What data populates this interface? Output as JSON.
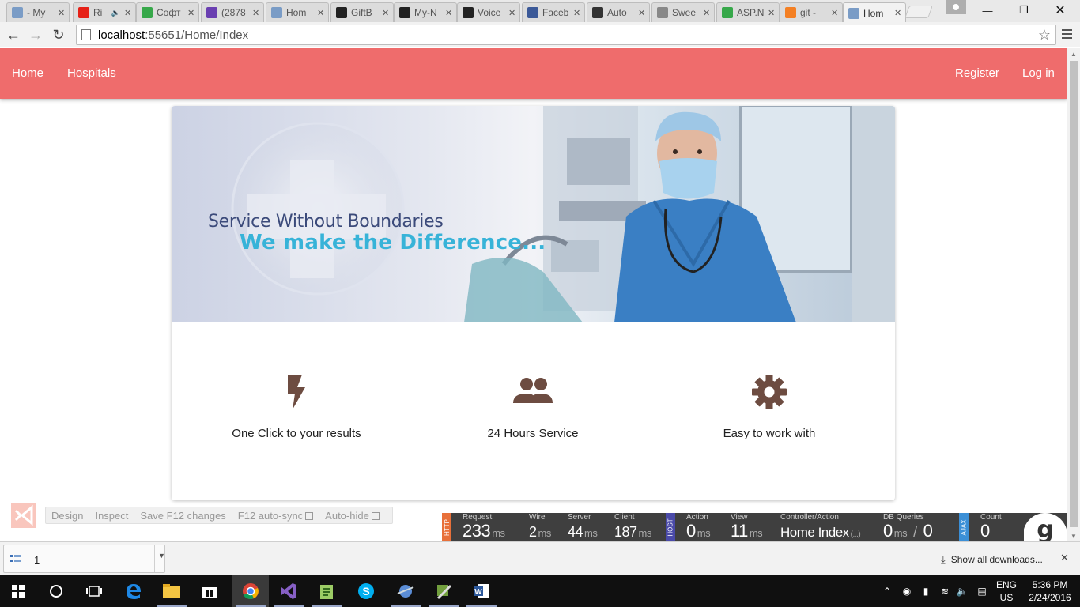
{
  "browser": {
    "tabs": [
      {
        "label": "- My",
        "favicon": "doc-icon",
        "color": "#7a9cc6"
      },
      {
        "label": "Ri",
        "favicon": "youtube-icon",
        "color": "#e62117",
        "audio": true
      },
      {
        "label": "Софт",
        "favicon": "green-logo-icon",
        "color": "#37a84a"
      },
      {
        "label": "(2878",
        "favicon": "mail-icon",
        "color": "#6a3fb1"
      },
      {
        "label": "Hom",
        "favicon": "doc-icon",
        "color": "#7a9cc6"
      },
      {
        "label": "GiftB",
        "favicon": "github-icon",
        "color": "#222222"
      },
      {
        "label": "My-N",
        "favicon": "github-icon",
        "color": "#222222"
      },
      {
        "label": "Voice",
        "favicon": "github-icon",
        "color": "#222222"
      },
      {
        "label": "Faceb",
        "favicon": "facebook-icon",
        "color": "#3b5998"
      },
      {
        "label": "Auto",
        "favicon": "factory-icon",
        "color": "#333333"
      },
      {
        "label": "Swee",
        "favicon": "page-icon",
        "color": "#888888"
      },
      {
        "label": "ASP.N",
        "favicon": "green-logo-icon",
        "color": "#37a84a"
      },
      {
        "label": "git -",
        "favicon": "stackoverflow-icon",
        "color": "#f48024"
      },
      {
        "label": "Hom",
        "favicon": "doc-icon",
        "color": "#7a9cc6",
        "active": true
      }
    ],
    "url_host": "localhost",
    "url_rest": ":55651/Home/Index"
  },
  "site": {
    "nav_left": [
      "Home",
      "Hospitals"
    ],
    "nav_right": [
      "Register",
      "Log in"
    ],
    "accent": "#ef6c6c",
    "banner": {
      "line1": "Service Without Boundaries",
      "line2": "We make the Difference..."
    },
    "features": [
      {
        "icon": "lightning-bolt-icon",
        "label": "One Click to your results"
      },
      {
        "icon": "people-icon",
        "label": "24 Hours Service"
      },
      {
        "icon": "gear-icon",
        "label": "Easy to work with"
      }
    ],
    "icon_color": "#6d4c41"
  },
  "browser_link": {
    "items": [
      "Design",
      "Inspect",
      "Save F12 changes",
      "F12 auto-sync",
      "Auto-hide"
    ]
  },
  "glimpse": {
    "tags": [
      "HTTP",
      "HOST",
      "AJAX"
    ],
    "request": {
      "label": "Request",
      "value": "233",
      "unit": "ms"
    },
    "wire": {
      "label": "Wire",
      "value": "2",
      "unit": "ms"
    },
    "server": {
      "label": "Server",
      "value": "44",
      "unit": "ms"
    },
    "client": {
      "label": "Client",
      "value": "187",
      "unit": "ms"
    },
    "action": {
      "label": "Action",
      "value": "0",
      "unit": "ms"
    },
    "view": {
      "label": "View",
      "value": "11",
      "unit": "ms"
    },
    "controller": {
      "label": "Controller/Action",
      "value": "Home Index",
      "suffix": "(...)"
    },
    "db": {
      "label": "DB Queries",
      "value": "0",
      "unit": "ms",
      "sep": "/",
      "count": "0"
    },
    "ajax": {
      "label": "Count",
      "value": "0"
    }
  },
  "downloads": {
    "item_name": "1",
    "show_all": "Show all downloads..."
  },
  "taskbar": {
    "language": "ENG",
    "region": "US",
    "time": "5:36 PM",
    "date": "2/24/2016"
  }
}
